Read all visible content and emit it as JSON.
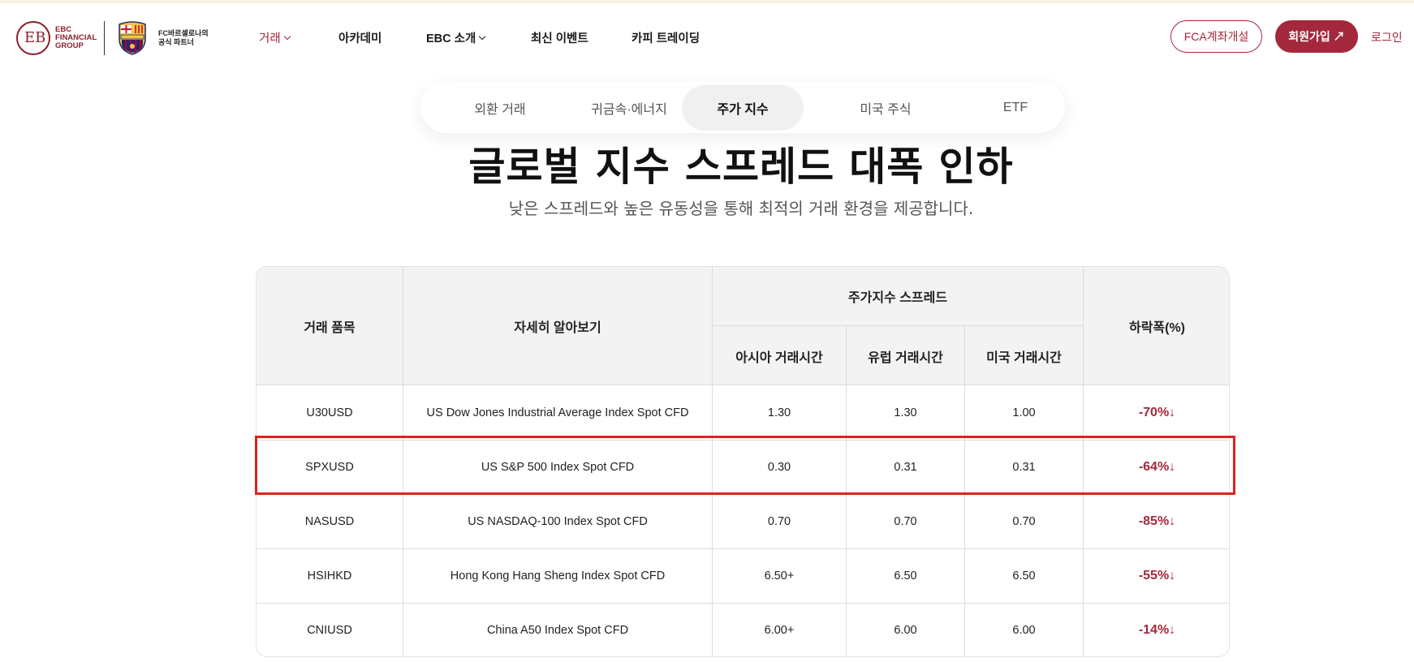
{
  "header": {
    "logo_ebc_lines": [
      "EBC",
      "FINANCIAL",
      "GROUP"
    ],
    "logo_fcb_lines": [
      "FC바르셀로나의",
      "공식 파트너"
    ],
    "nav": [
      {
        "label": "거래",
        "dropdown": true,
        "active": true
      },
      {
        "label": "아카데미",
        "dropdown": false,
        "active": false
      },
      {
        "label": "EBC 소개",
        "dropdown": true,
        "active": false
      },
      {
        "label": "최신 이벤트",
        "dropdown": false,
        "active": false
      },
      {
        "label": "카피 트레이딩",
        "dropdown": false,
        "active": false
      }
    ],
    "fca_button": "FCA계좌개설",
    "signup_button": "회원가입 ↗",
    "login_link": "로그인"
  },
  "tabs": [
    {
      "label": "외환 거래",
      "active": false
    },
    {
      "label": "귀금속·에너지",
      "active": false
    },
    {
      "label": "주가 지수",
      "active": true
    },
    {
      "label": "미국 주식",
      "active": false
    },
    {
      "label": "ETF",
      "active": false
    }
  ],
  "hero": {
    "title": "글로벌 지수 스프레드 대폭 인하",
    "subtitle": "낮은 스프레드와 높은 유동성을 통해 최적의 거래 환경을 제공합니다."
  },
  "table": {
    "headers": {
      "symbol": "거래 품목",
      "details": "자세히 알아보기",
      "spread_group": "주가지수 스프레드",
      "asia": "아시아 거래시간",
      "europe": "유럽 거래시간",
      "us": "미국 거래시간",
      "drop": "하락폭(%)"
    },
    "rows": [
      {
        "symbol": "U30USD",
        "details": "US Dow Jones Industrial Average Index Spot CFD",
        "asia": "1.30",
        "europe": "1.30",
        "us": "1.00",
        "drop": "-70%↓"
      },
      {
        "symbol": "SPXUSD",
        "details": "US S&P 500 Index Spot CFD",
        "asia": "0.30",
        "europe": "0.31",
        "us": "0.31",
        "drop": "-64%↓"
      },
      {
        "symbol": "NASUSD",
        "details": "US NASDAQ-100 Index Spot CFD",
        "asia": "0.70",
        "europe": "0.70",
        "us": "0.70",
        "drop": "-85%↓"
      },
      {
        "symbol": "HSIHKD",
        "details": "Hong Kong Hang Sheng Index Spot CFD",
        "asia": "6.50+",
        "europe": "6.50",
        "us": "6.50",
        "drop": "-55%↓"
      },
      {
        "symbol": "CNIUSD",
        "details": "China A50 Index Spot CFD",
        "asia": "6.00+",
        "europe": "6.00",
        "us": "6.00",
        "drop": "-14%↓"
      }
    ]
  },
  "colors": {
    "brand": "#a3283b",
    "highlight_box": "#e0211f",
    "header_bg": "#f3f3f3"
  }
}
